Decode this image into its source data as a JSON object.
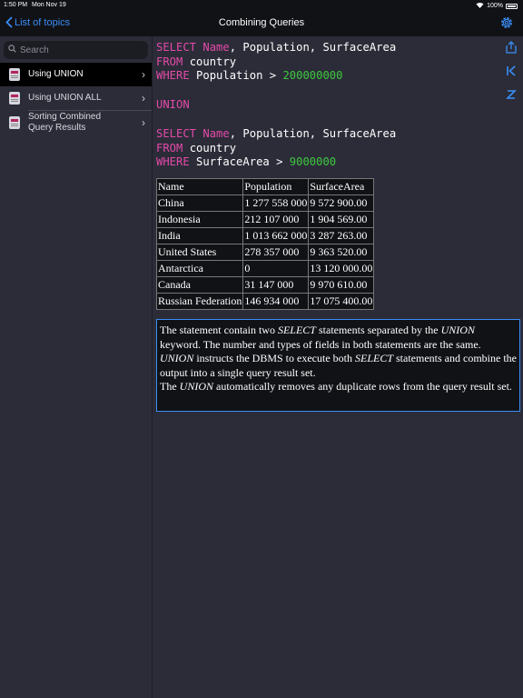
{
  "status": {
    "time": "1:50 PM",
    "date": "Mon Nov 19",
    "battery": "100%"
  },
  "nav": {
    "back_label": "List of topics",
    "title": "Combining Queries"
  },
  "sidebar": {
    "search_placeholder": "Search",
    "items": [
      {
        "label": "Using UNION"
      },
      {
        "label": "Using UNION ALL"
      },
      {
        "label": "Sorting Combined Query Results"
      }
    ]
  },
  "query": {
    "select1_kw": "SELECT",
    "select1_fields": "Population, SurfaceArea",
    "select1_name": "Name",
    "from_kw": "FROM",
    "table_name": "country",
    "where_kw": "WHERE",
    "where1_field": "Population >",
    "where1_value": "200000000",
    "union_kw": "UNION",
    "where2_field": "SurfaceArea >",
    "where2_value": "9000000"
  },
  "result": {
    "headers": [
      "Name",
      "Population",
      "SurfaceArea"
    ],
    "rows": [
      [
        "China",
        "1 277 558 000",
        "9 572 900.00"
      ],
      [
        "Indonesia",
        "212 107 000",
        "1 904 569.00"
      ],
      [
        "India",
        "1 013 662 000",
        "3 287 263.00"
      ],
      [
        "United States",
        "278 357 000",
        "9 363 520.00"
      ],
      [
        "Antarctica",
        "0",
        "13 120 000.00"
      ],
      [
        "Canada",
        "31 147 000",
        "9 970 610.00"
      ],
      [
        "Russian Federation",
        "146 934 000",
        "17 075 400.00"
      ]
    ]
  },
  "note": {
    "p1_a": "The statement contain two ",
    "p1_b": "SELECT",
    "p1_c": " statements separated by the ",
    "p1_d": "UNION",
    "p1_e": " keyword. The number and types of fields in both statements are the same. ",
    "p1_f": "UNION",
    "p1_g": " instructs the DBMS to execute both ",
    "p1_h": "SELECT",
    "p1_i": " statements and combine the output into a single query result set.",
    "p2_a": "The ",
    "p2_b": "UNION",
    "p2_c": " automatically removes any duplicate rows from the query result set."
  },
  "colors": {
    "accent": "#3a8ef6",
    "keyword": "#e34aa8",
    "number": "#3ec83e",
    "background": "#2b2c38",
    "bar": "#111216"
  },
  "icons": [
    "wifi-icon",
    "battery-icon",
    "chevron-left-icon",
    "gear-icon",
    "search-icon",
    "document-icon",
    "chevron-right-icon",
    "share-icon",
    "first-page-icon",
    "sleep-icon"
  ]
}
